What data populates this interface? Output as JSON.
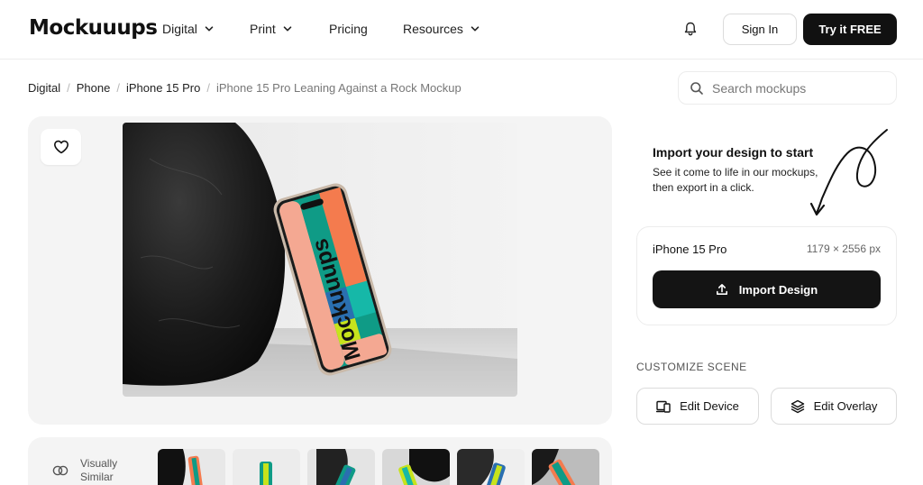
{
  "header": {
    "logo": "Mockuuups",
    "nav": [
      {
        "label": "Digital"
      },
      {
        "label": "Print"
      },
      {
        "label": "Pricing"
      },
      {
        "label": "Resources"
      }
    ],
    "sign_in": "Sign In",
    "try_free": "Try it FREE"
  },
  "breadcrumb": {
    "items": [
      "Digital",
      "Phone",
      "iPhone 15 Pro"
    ],
    "separator": "/",
    "current": "iPhone 15 Pro Leaning Against a Rock Mockup"
  },
  "search": {
    "placeholder": "Search mockups",
    "value": ""
  },
  "preview": {
    "mockup_text": "Mockuuups",
    "screen_colors": [
      "#f4a892",
      "#0f9b86",
      "#f47b4e",
      "#2a6fb0",
      "#c7e31c",
      "#16b8a8"
    ]
  },
  "import_panel": {
    "title": "Import your design to start",
    "subtitle": "See it come to life in our mockups, then export in a click.",
    "device_name": "iPhone 15 Pro",
    "device_dims": "1179 × 2556 px",
    "import_button": "Import Design"
  },
  "customize": {
    "label": "CUSTOMIZE SCENE",
    "edit_device": "Edit Device",
    "edit_overlay": "Edit Overlay"
  },
  "similar": {
    "label_line1": "Visually",
    "label_line2": "Similar",
    "thumb_count": 6
  },
  "colors": {
    "primary_button": "#111111",
    "panel_bg": "#f4f4f4",
    "border": "#ececec"
  }
}
